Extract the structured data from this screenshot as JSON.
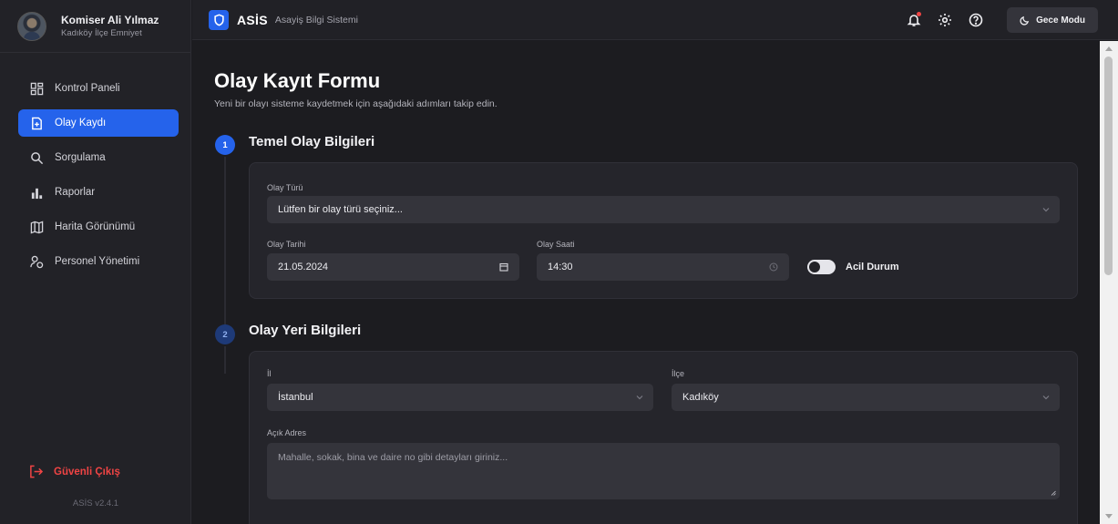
{
  "user": {
    "name": "Komiser Ali Yılmaz",
    "unit": "Kadıköy İlçe Emniyet"
  },
  "sidebar": {
    "items": [
      {
        "label": "Kontrol Paneli",
        "icon": "dashboard-icon"
      },
      {
        "label": "Olay Kaydı",
        "icon": "file-plus-icon",
        "active": true
      },
      {
        "label": "Sorgulama",
        "icon": "search-icon"
      },
      {
        "label": "Raporlar",
        "icon": "bar-chart-icon"
      },
      {
        "label": "Harita Görünümü",
        "icon": "map-icon"
      },
      {
        "label": "Personel Yönetimi",
        "icon": "users-icon"
      }
    ],
    "logout": "Güvenli Çıkış",
    "version": "ASİS v2.4.1"
  },
  "header": {
    "brand": "ASİS",
    "subtitle": "Asayiş Bilgi Sistemi",
    "night_mode": "Gece Modu"
  },
  "page": {
    "title": "Olay Kayıt Formu",
    "subtitle": "Yeni bir olayı sisteme kaydetmek için aşağıdaki adımları takip edin."
  },
  "steps": [
    {
      "number": "1",
      "title": "Temel Olay Bilgileri",
      "fields": {
        "event_type_label": "Olay Türü",
        "event_type_placeholder": "Lütfen bir olay türü seçiniz...",
        "date_label": "Olay Tarihi",
        "date_value": "21.05.2024",
        "time_label": "Olay Saati",
        "time_value": "14:30",
        "emergency_label": "Acil Durum",
        "emergency_on": false
      }
    },
    {
      "number": "2",
      "title": "Olay Yeri Bilgileri",
      "fields": {
        "province_label": "İl",
        "province_value": "İstanbul",
        "district_label": "İlçe",
        "district_value": "Kadıköy",
        "address_label": "Açık Adres",
        "address_placeholder": "Mahalle, sokak, bina ve daire no gibi detayları giriniz..."
      }
    }
  ],
  "colors": {
    "accent": "#2563eb",
    "danger": "#ef4444",
    "background": "#1c1c20",
    "card": "#25252b",
    "input": "#34343b"
  }
}
